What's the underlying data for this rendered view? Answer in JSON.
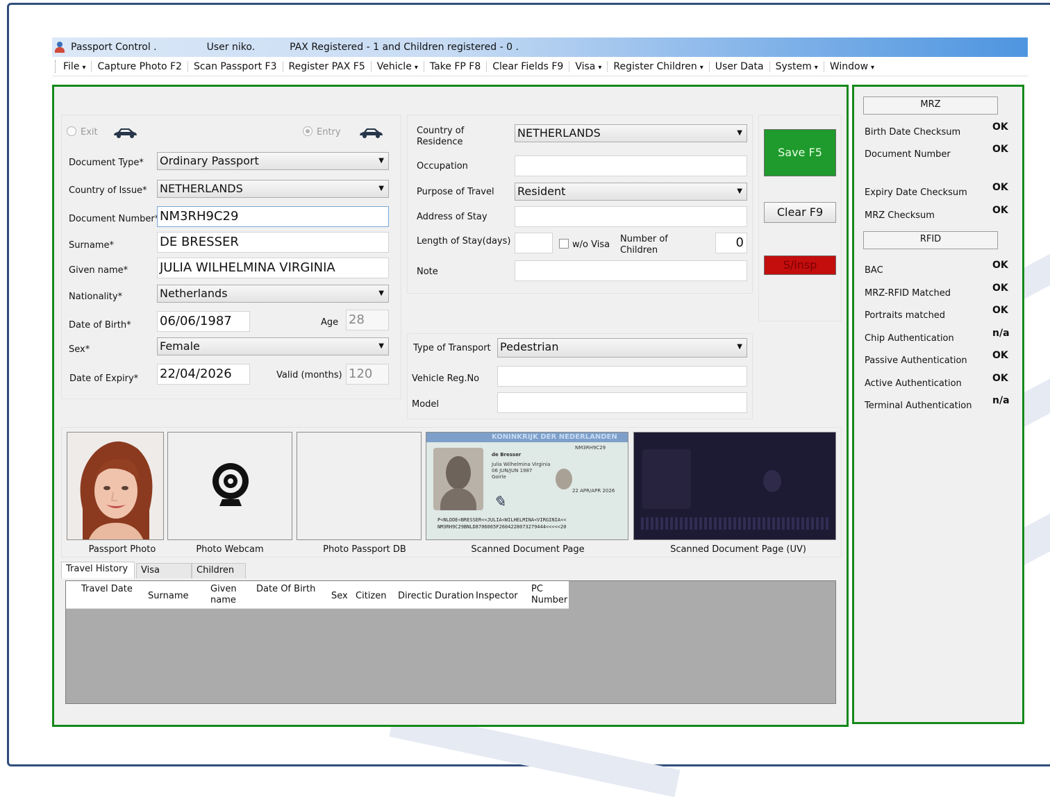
{
  "titlebar": {
    "app": "Passport Control .",
    "user": "User  niko.",
    "pax": "PAX Registered - 1   and Children registered - 0  ."
  },
  "menu": [
    {
      "label": "File",
      "dropdown": true
    },
    {
      "label": "Capture Photo  F2",
      "dropdown": false
    },
    {
      "label": "Scan Passport F3",
      "dropdown": false
    },
    {
      "label": "Register PAX F5",
      "dropdown": false
    },
    {
      "label": "Vehicle",
      "dropdown": true
    },
    {
      "label": "Take FP F8",
      "dropdown": false
    },
    {
      "label": "Clear Fields F9",
      "dropdown": false
    },
    {
      "label": "Visa",
      "dropdown": true
    },
    {
      "label": "Register Children",
      "dropdown": true
    },
    {
      "label": "User Data",
      "dropdown": false
    },
    {
      "label": "System",
      "dropdown": true
    },
    {
      "label": "Window",
      "dropdown": true
    }
  ],
  "direction": {
    "exit_label": "Exit",
    "entry_label": "Entry",
    "selected": "Entry"
  },
  "form": {
    "document_type": {
      "label": "Document Type*",
      "value": "Ordinary Passport"
    },
    "country_of_issue": {
      "label": "Country of Issue*",
      "value": "NETHERLANDS"
    },
    "document_number": {
      "label": "Document Number*",
      "value": "NM3RH9C29"
    },
    "surname": {
      "label": "Surname*",
      "value": "DE BRESSER"
    },
    "given_name": {
      "label": "Given name*",
      "value": "JULIA WILHELMINA VIRGINIA"
    },
    "nationality": {
      "label": "Nationality*",
      "value": "Netherlands"
    },
    "date_of_birth": {
      "label": "Date of Birth*",
      "value": "06/06/1987"
    },
    "age": {
      "label": "Age",
      "value": "28"
    },
    "sex": {
      "label": "Sex*",
      "value": "Female"
    },
    "date_of_expiry": {
      "label": "Date of Expiry*",
      "value": "22/04/2026"
    },
    "valid_months": {
      "label": "Valid (months)",
      "value": "120"
    }
  },
  "stay": {
    "country_of_residence": {
      "label": "Country of Residence",
      "value": "NETHERLANDS"
    },
    "occupation": {
      "label": "Occupation",
      "value": ""
    },
    "purpose_of_travel": {
      "label": "Purpose of Travel",
      "value": "Resident"
    },
    "address_of_stay": {
      "label": "Address of Stay",
      "value": ""
    },
    "length_of_stay": {
      "label": "Length of Stay(days)",
      "value": ""
    },
    "wo_visa": {
      "label": "w/o Visa",
      "checked": false
    },
    "number_of_children": {
      "label": "Number of Children",
      "value": "0"
    },
    "note": {
      "label": "Note",
      "value": ""
    }
  },
  "buttons": {
    "save": "Save F5",
    "clear": "Clear F9",
    "insp": "S/insp"
  },
  "transport": {
    "type": {
      "label": "Type of  Transport",
      "value": "Pedestrian"
    },
    "vehicle_reg": {
      "label": "Vehicle Reg.No",
      "value": ""
    },
    "model": {
      "label": "Model",
      "value": ""
    }
  },
  "images": {
    "passport_photo": "Passport Photo",
    "photo_webcam": "Photo Webcam",
    "photo_passport_db": "Photo Passport DB",
    "scanned_page": "Scanned Document Page",
    "scanned_page_uv": "Scanned Document Page (UV)"
  },
  "scan": {
    "header": "KONINKRIJK DER NEDERLANDEN",
    "doc_no": "NM3RH9C29",
    "surname": "de Bresser",
    "given": "Julia Wilhelmina Virginia",
    "dob": "06 JUN/JUN 1987",
    "place": "Goirle",
    "expiry": "22 APR/APR 2026",
    "mrz1": "P<NLDDE<BRESSER<<JULIA<WILHELMINA<VIRGINIA<<",
    "mrz2": "NM3RH9C29BNLD8706065F2604228073279444<<<<<20"
  },
  "tabs": [
    {
      "label": "Travel History",
      "active": true
    },
    {
      "label": "Visa",
      "active": false
    },
    {
      "label": "Children",
      "active": false
    }
  ],
  "history_columns": [
    "Travel Date",
    "Surname",
    "Given name",
    "Date Of Birth",
    "Sex",
    "Citizen",
    "Directic",
    "Duration",
    "Inspector",
    "PC Number"
  ],
  "checks": {
    "mrz_header": "MRZ",
    "rfid_header": "RFID",
    "mrz": [
      {
        "label": "Birth Date Checksum",
        "value": "OK"
      },
      {
        "label": "Document Number",
        "value": "OK"
      },
      {
        "label": "Expiry Date Checksum",
        "value": "OK"
      },
      {
        "label": "MRZ Checksum",
        "value": "OK"
      }
    ],
    "rfid": [
      {
        "label": "BAC",
        "value": "OK"
      },
      {
        "label": "MRZ-RFID Matched",
        "value": "OK"
      },
      {
        "label": "Portraits matched",
        "value": "OK"
      },
      {
        "label": "Chip Authentication",
        "value": "n/a"
      },
      {
        "label": "Passive Authentication",
        "value": "OK"
      },
      {
        "label": "Active Authentication",
        "value": "OK"
      },
      {
        "label": "Terminal Authentication",
        "value": "n/a"
      }
    ]
  }
}
